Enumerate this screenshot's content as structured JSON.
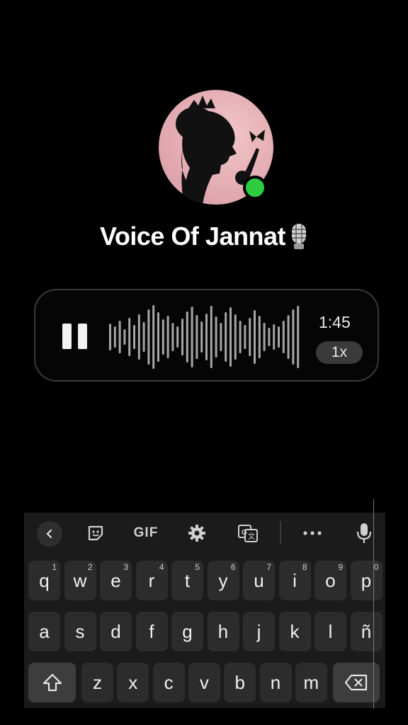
{
  "profile": {
    "name": "Voice Of Jannat",
    "online_color": "#2ecc40"
  },
  "voice_message": {
    "duration": "1:45",
    "speed": "1x",
    "state": "playing"
  },
  "keyboard": {
    "toolbar": [
      "back-icon",
      "sticker-icon",
      "GIF",
      "gear-icon",
      "translate-icon",
      "more-icon",
      "mic-icon"
    ],
    "gif_label": "GIF",
    "row1": [
      {
        "key": "q",
        "hint": "1"
      },
      {
        "key": "w",
        "hint": "2"
      },
      {
        "key": "e",
        "hint": "3"
      },
      {
        "key": "r",
        "hint": "4"
      },
      {
        "key": "t",
        "hint": "5"
      },
      {
        "key": "y",
        "hint": "6"
      },
      {
        "key": "u",
        "hint": "7"
      },
      {
        "key": "i",
        "hint": "8"
      },
      {
        "key": "o",
        "hint": "9"
      },
      {
        "key": "p",
        "hint": "0"
      }
    ],
    "row2": [
      "a",
      "s",
      "d",
      "f",
      "g",
      "h",
      "j",
      "k",
      "l",
      "ñ"
    ],
    "row3": [
      "z",
      "x",
      "c",
      "v",
      "b",
      "n",
      "m"
    ]
  }
}
